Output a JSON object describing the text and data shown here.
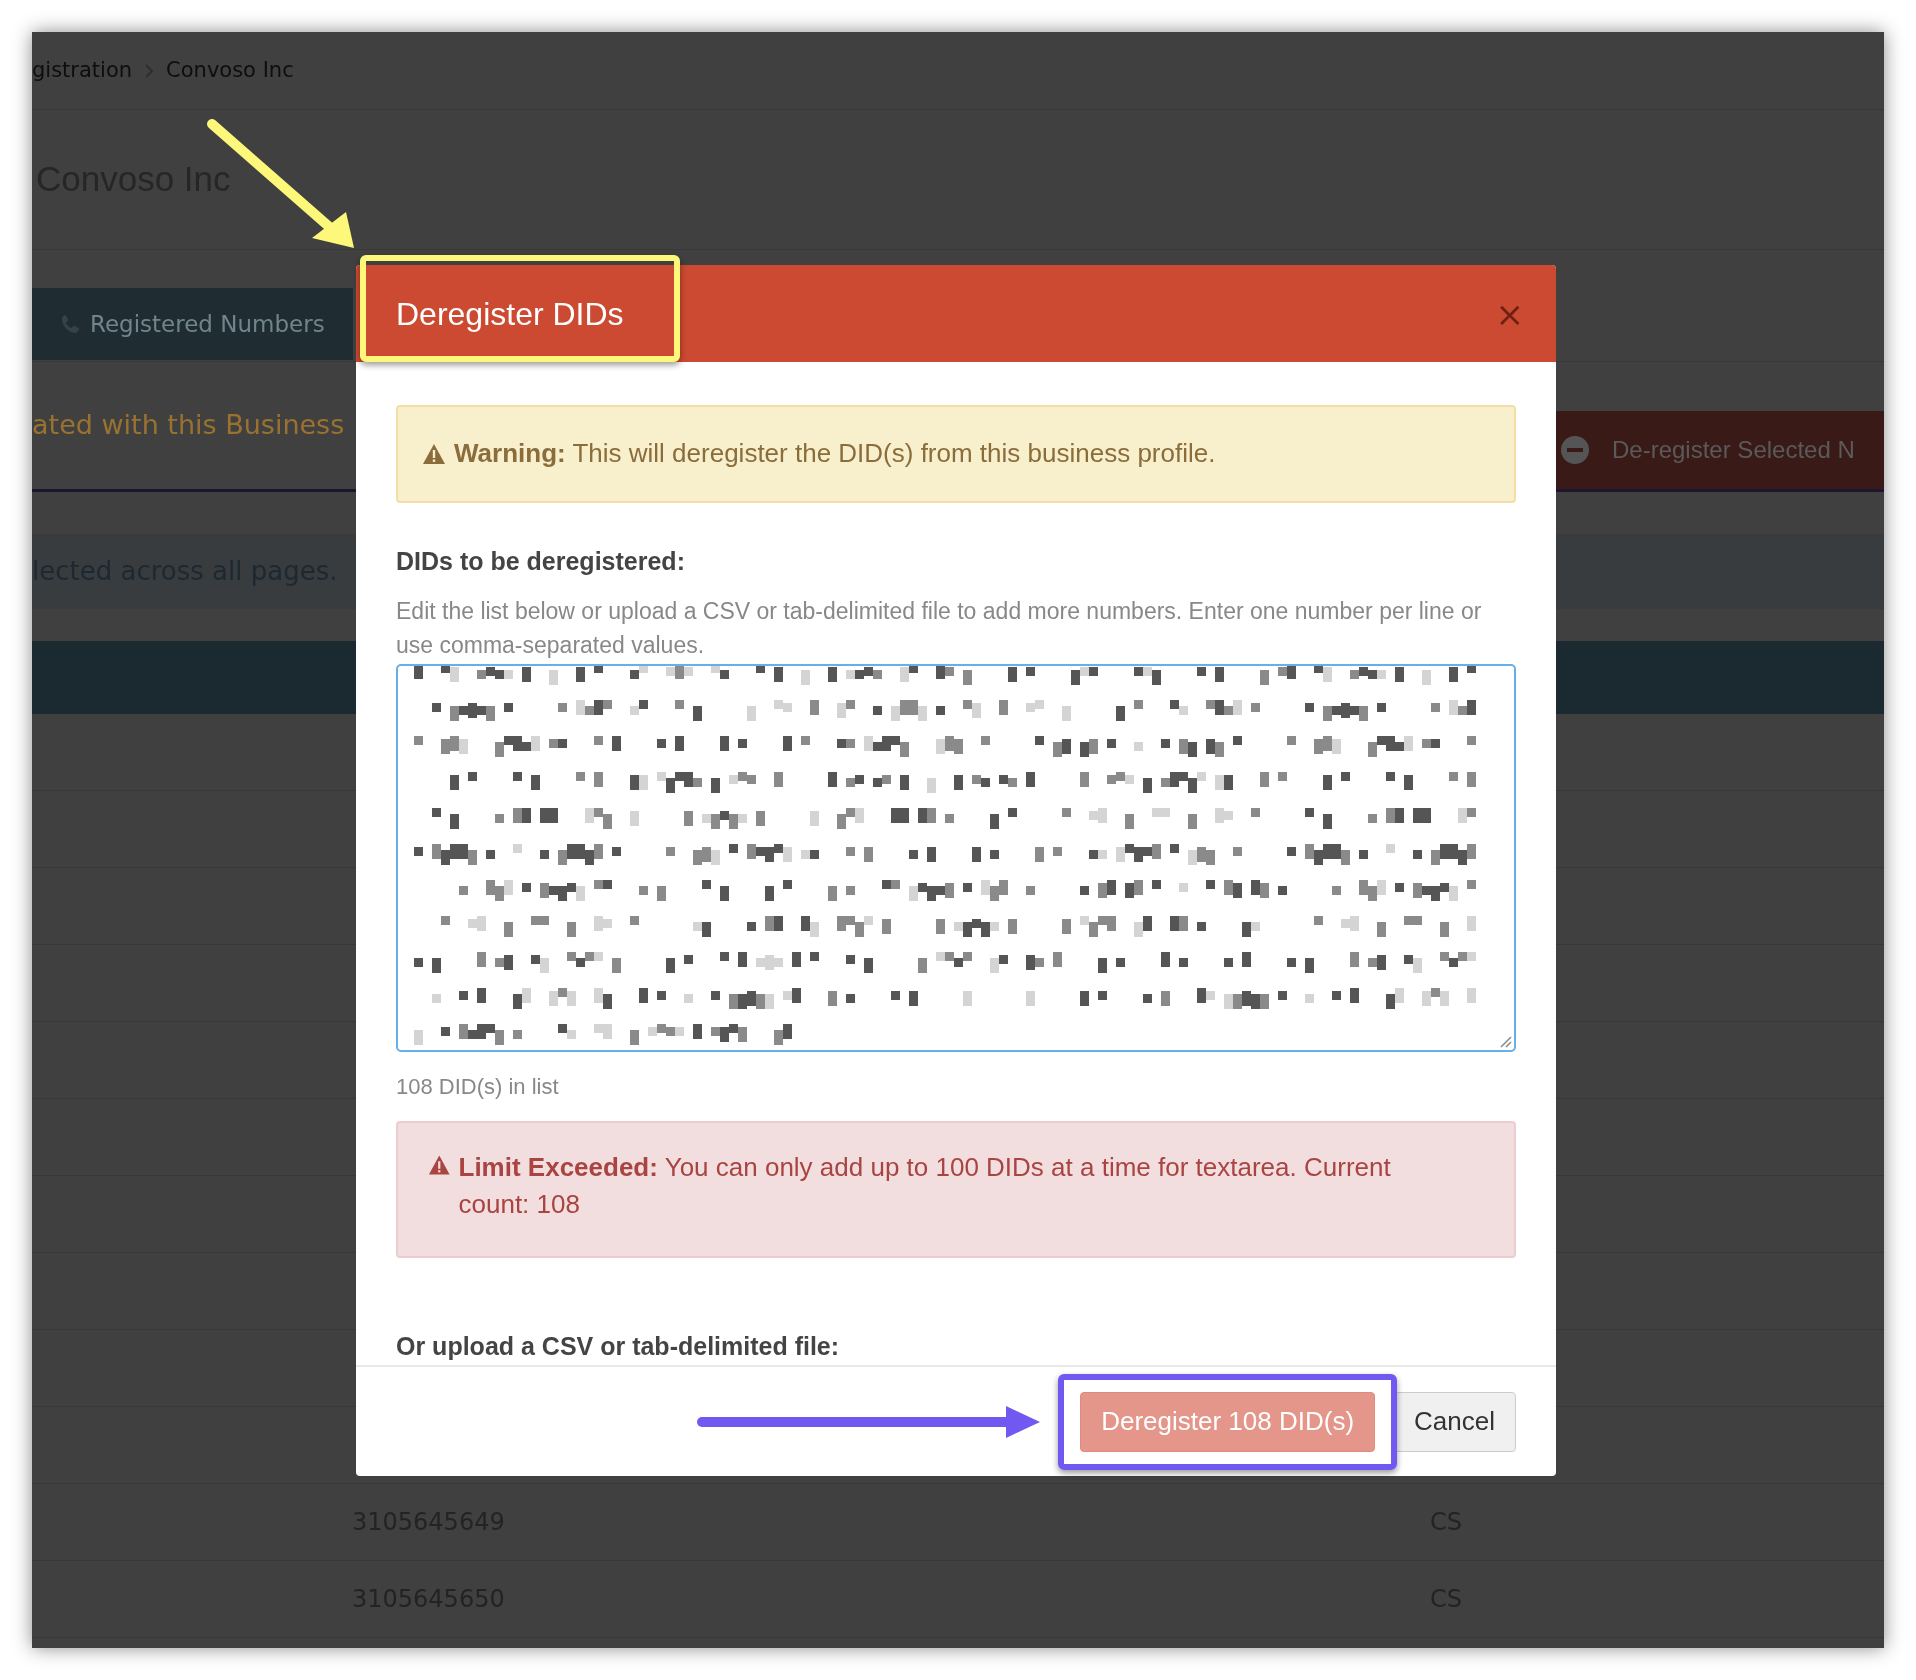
{
  "breadcrumb": [
    {
      "label": "gistration"
    },
    {
      "label": "Convoso Inc"
    }
  ],
  "page_title": "Convoso Inc",
  "tabs": [
    {
      "label": "Registered Numbers",
      "selected": true
    }
  ],
  "section_heading": "ated with this Business",
  "deregister_selected_button": {
    "label": "De-register Selected N"
  },
  "selection_notice": "lected across all pages.",
  "table": {
    "rows": [
      {
        "column_1": "3105645649",
        "column_2": "CS"
      },
      {
        "column_1": "3105645650",
        "column_2": "CS"
      }
    ]
  },
  "modal": {
    "title": "Deregister DIDs",
    "title_highlighted": true,
    "close_label": "×",
    "warning": "**Warning:** This will deregister the DID(s) from this business profile.",
    "list_label": "DIDs to be deregistered:",
    "help_text": "Edit the list below or upload a CSV or tab-delimited file to add more numbers. Enter one number per line or use comma-separated values.",
    "count_text": "108 DID(s) in list",
    "error": "**Limit Exceeded:** You can only add up to 100 DIDs at a time for textarea. Current count: 108",
    "upload_label": "Or upload a CSV or tab-delimited file:",
    "buttons": [
      {
        "label": "Deregister 108 DID(s)",
        "kind": "primary",
        "disabled": true,
        "highlighted": true
      },
      {
        "label": "Cancel",
        "kind": "secondary",
        "disabled": false,
        "highlighted": false
      }
    ]
  }
}
